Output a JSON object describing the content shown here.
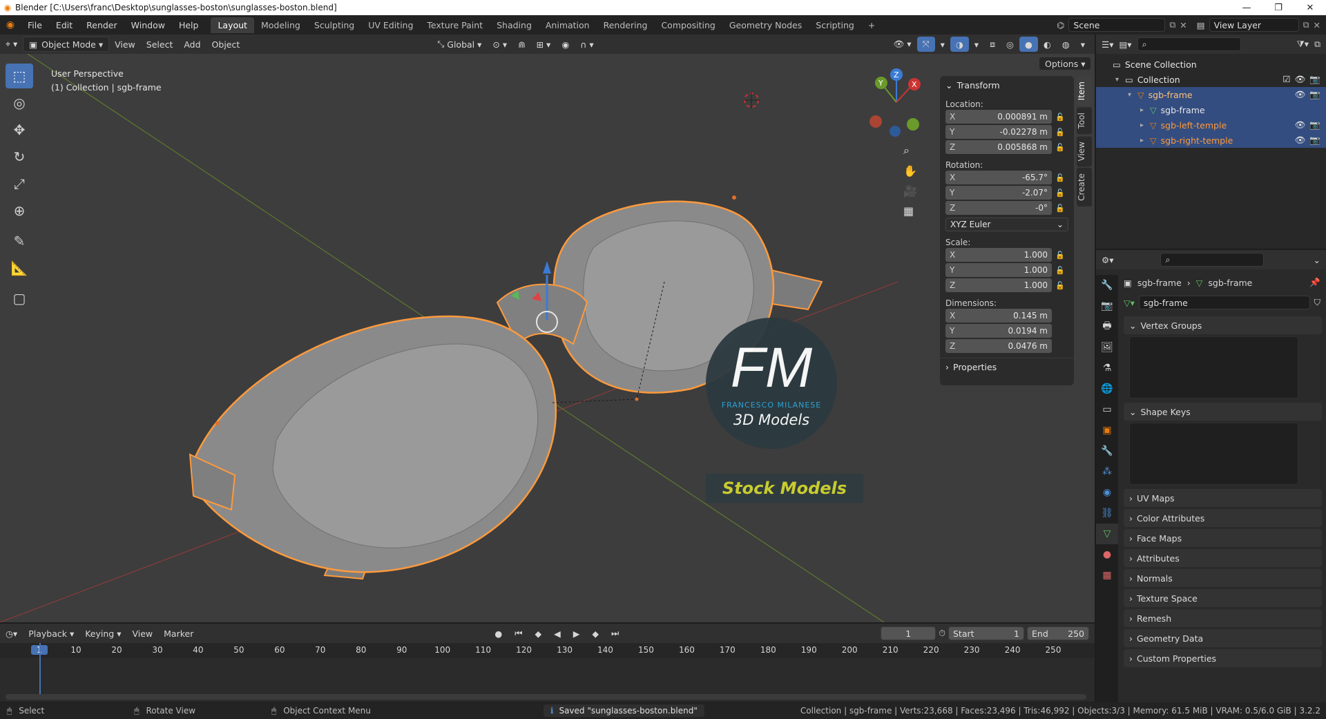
{
  "window": {
    "title": "Blender [C:\\Users\\franc\\Desktop\\sunglasses-boston\\sunglasses-boston.blend]",
    "min": "—",
    "max": "❐",
    "close": "✕"
  },
  "menu": [
    "File",
    "Edit",
    "Render",
    "Window",
    "Help"
  ],
  "workspaces": [
    "Layout",
    "Modeling",
    "Sculpting",
    "UV Editing",
    "Texture Paint",
    "Shading",
    "Animation",
    "Rendering",
    "Compositing",
    "Geometry Nodes",
    "Scripting"
  ],
  "scene_field": "Scene",
  "view_layer_field": "View Layer",
  "viewport_header": {
    "mode": "Object Mode",
    "menus": [
      "View",
      "Select",
      "Add",
      "Object"
    ],
    "orientation": "Global",
    "options": "Options"
  },
  "viewport": {
    "perspective": "User Perspective",
    "context": "(1) Collection | sgb-frame",
    "watermark_fm": "FM",
    "watermark_name": "FRANCESCO MILANESE",
    "watermark_sub": "3D Models",
    "watermark_banner": "Stock Models"
  },
  "npanel": {
    "header": "Transform",
    "location_label": "Location:",
    "location": [
      {
        "ax": "X",
        "v": "0.000891 m"
      },
      {
        "ax": "Y",
        "v": "-0.02278 m"
      },
      {
        "ax": "Z",
        "v": "0.005868 m"
      }
    ],
    "rotation_label": "Rotation:",
    "rotation": [
      {
        "ax": "X",
        "v": "-65.7°"
      },
      {
        "ax": "Y",
        "v": "-2.07°"
      },
      {
        "ax": "Z",
        "v": "-0°"
      }
    ],
    "rotation_mode": "XYZ Euler",
    "scale_label": "Scale:",
    "scale": [
      {
        "ax": "X",
        "v": "1.000"
      },
      {
        "ax": "Y",
        "v": "1.000"
      },
      {
        "ax": "Z",
        "v": "1.000"
      }
    ],
    "dimensions_label": "Dimensions:",
    "dimensions": [
      {
        "ax": "X",
        "v": "0.145 m"
      },
      {
        "ax": "Y",
        "v": "0.0194 m"
      },
      {
        "ax": "Z",
        "v": "0.0476 m"
      }
    ],
    "properties": "Properties",
    "tabs": [
      "Item",
      "Tool",
      "View",
      "Create"
    ]
  },
  "outliner": {
    "rows": [
      {
        "label": "Scene Collection",
        "indent": 0,
        "sel": false
      },
      {
        "label": "Collection",
        "indent": 1,
        "sel": false
      },
      {
        "label": "sgb-frame",
        "indent": 2,
        "sel": true
      },
      {
        "label": "sgb-frame",
        "indent": 3,
        "sel": true
      },
      {
        "label": "sgb-left-temple",
        "indent": 3,
        "sel": true
      },
      {
        "label": "sgb-right-temple",
        "indent": 3,
        "sel": true
      }
    ]
  },
  "properties": {
    "breadcrumb_obj": "sgb-frame",
    "breadcrumb_data": "sgb-frame",
    "mesh_name": "sgb-frame",
    "sections_top": [
      "Vertex Groups",
      "Shape Keys"
    ],
    "sections": [
      "UV Maps",
      "Color Attributes",
      "Face Maps",
      "Attributes",
      "Normals",
      "Texture Space",
      "Remesh",
      "Geometry Data",
      "Custom Properties"
    ]
  },
  "timeline": {
    "menus": [
      "Playback",
      "Keying",
      "View",
      "Marker"
    ],
    "current_frame": "1",
    "start_label": "Start",
    "start": "1",
    "end_label": "End",
    "end": "250",
    "ticks": [
      "1",
      "10",
      "20",
      "30",
      "40",
      "50",
      "60",
      "70",
      "80",
      "90",
      "100",
      "110",
      "120",
      "130",
      "140",
      "150",
      "160",
      "170",
      "180",
      "190",
      "200",
      "210",
      "220",
      "230",
      "240",
      "250"
    ]
  },
  "status": {
    "select": "Select",
    "rotate": "Rotate View",
    "context_menu": "Object Context Menu",
    "saved": "Saved \"sunglasses-boston.blend\"",
    "stats": "Collection | sgb-frame | Verts:23,668 | Faces:23,496 | Tris:46,992 | Objects:3/3 | Memory: 61.5 MiB | VRAM: 0.5/6.0 GiB | 3.2.2"
  },
  "colors": {
    "accent": "#4772b3",
    "selected_orange": "#ff9a3c",
    "blender_orange": "#e87d0d"
  }
}
